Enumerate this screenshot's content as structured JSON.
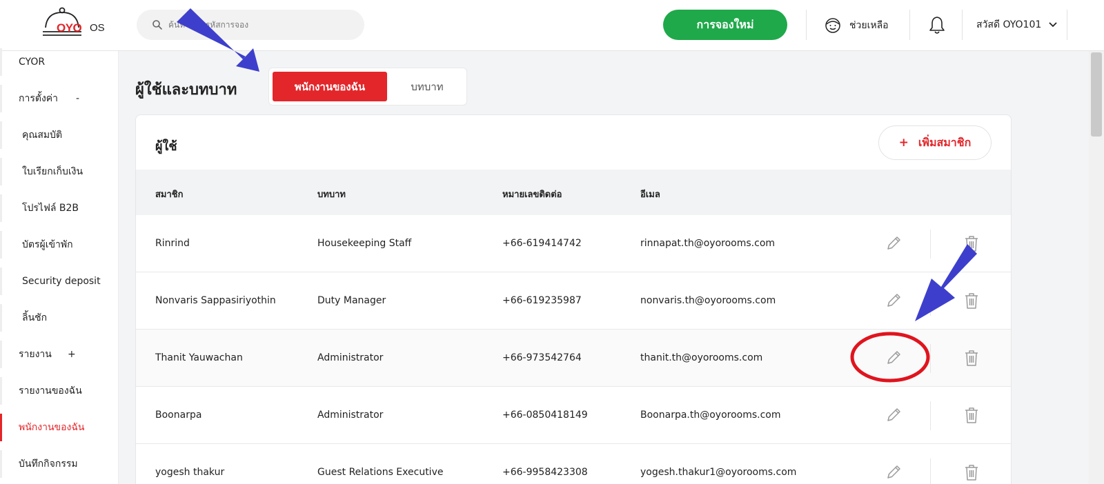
{
  "header": {
    "logo_text": "OYO",
    "logo_suffix": "OS",
    "search_placeholder": "ค้นหาชื่อ, รหัสการจอง",
    "new_booking_label": "การจองใหม่",
    "help_label": "ช่วยเหลือ",
    "user_greeting": "สวัสดี OYO101"
  },
  "sidebar": {
    "items": [
      {
        "label": "CYOR"
      },
      {
        "label": "การตั้งค่า",
        "sign": "-"
      },
      {
        "label": "คุณสมบัติ"
      },
      {
        "label": "ใบเรียกเก็บเงิน"
      },
      {
        "label": "โปรไฟล์ B2B"
      },
      {
        "label": "บัตรผู้เข้าพัก"
      },
      {
        "label": "Security deposit"
      },
      {
        "label": "ลิ้นชัก"
      },
      {
        "label": "รายงาน",
        "sign": "+"
      },
      {
        "label": "รายงานของฉัน"
      },
      {
        "label": "พนักงานของฉัน",
        "active": true
      },
      {
        "label": "บันทึกกิจกรรม"
      }
    ]
  },
  "page": {
    "title": "ผู้ใช้และบทบาท",
    "tabs": [
      {
        "label": "พนักงานของฉัน",
        "active": true
      },
      {
        "label": "บทบาท",
        "active": false
      }
    ]
  },
  "users_card": {
    "title": "ผู้ใช้",
    "add_button_plus": "+",
    "add_button_label": "เพิ่มสมาชิก",
    "columns": [
      "สมาชิก",
      "บทบาท",
      "หมายเลขติดต่อ",
      "อีเมล"
    ],
    "rows": [
      {
        "name": "Rinrind",
        "role": "Housekeeping Staff",
        "phone": "+66-619414742",
        "email": "rinnapat.th@oyorooms.com"
      },
      {
        "name": "Nonvaris Sappasiriyothin",
        "role": "Duty Manager",
        "phone": "+66-619235987",
        "email": "nonvaris.th@oyorooms.com"
      },
      {
        "name": "Thanit Yauwachan",
        "role": "Administrator",
        "phone": "+66-973542764",
        "email": "thanit.th@oyorooms.com"
      },
      {
        "name": "Boonarpa",
        "role": "Administrator",
        "phone": "+66-0850418149",
        "email": "Boonarpa.th@oyorooms.com"
      },
      {
        "name": "yogesh thakur",
        "role": "Guest Relations Executive",
        "phone": "+66-9958423308",
        "email": "yogesh.thakur1@oyorooms.com"
      }
    ]
  },
  "icons": {
    "search": "search-icon",
    "help": "help-face-icon",
    "bell": "bell-icon",
    "chevron": "chevron-down-icon",
    "edit": "pencil-icon",
    "delete": "trash-icon"
  },
  "colors": {
    "brand_red": "#e3262a",
    "new_booking_green": "#1fa94a",
    "annotation_arrow": "#3d3fcc",
    "annotation_circle": "#e0141e"
  }
}
